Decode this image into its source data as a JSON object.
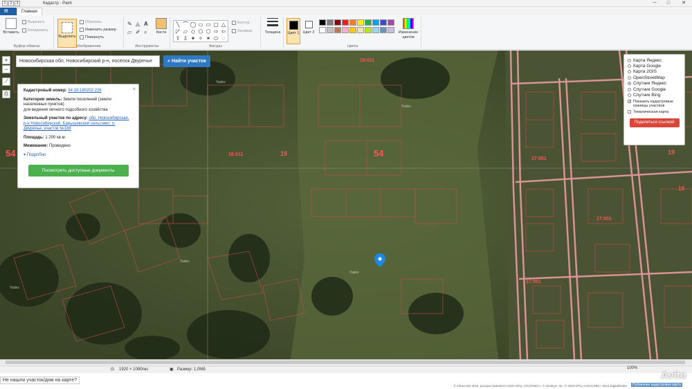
{
  "window": {
    "title": "Кадастр - Paint",
    "quick_access": [
      "1",
      "2",
      "3"
    ],
    "controls": {
      "minimize": "─",
      "maximize": "□",
      "close": "✕"
    }
  },
  "tabs": [
    {
      "label": "Главная",
      "active": true
    }
  ],
  "ribbon": {
    "clipboard": {
      "paste": "Вставить",
      "cut": "Вырезать",
      "copy": "Копировать",
      "group": "Буфер обмена"
    },
    "image": {
      "select": "Выделить",
      "crop": "Обрезать",
      "resize": "Изменить размер",
      "rotate": "Повернуть",
      "group": "Изображение"
    },
    "tools": {
      "group": "Инструменты",
      "brushes": "Кисти"
    },
    "shapes": {
      "group": "Фигуры",
      "outline": "Контур",
      "fill": "Заливка",
      "glyphs": [
        "╲",
        "⌒",
        "◯",
        "▭",
        "▭",
        "▢",
        "△",
        "◸",
        "▱",
        "◇",
        "⬠",
        "⬡",
        "⇨",
        "⇦",
        "⇧",
        "⇩",
        "✦",
        "✧",
        "✶",
        "⬭",
        "◌"
      ]
    },
    "thickness": "Толщина",
    "colors": {
      "group": "Цвета",
      "color1": "Цвет 1",
      "color2": "Цвет 2",
      "edit": "Изменение цветов",
      "palette": [
        "#000000",
        "#7f7f7f",
        "#880015",
        "#ed1c24",
        "#ff7f27",
        "#fff200",
        "#22b14c",
        "#00a2e8",
        "#3f48cc",
        "#a349a4",
        "#ffffff",
        "#c3c3c3",
        "#b97a57",
        "#ffaec9",
        "#ffc90e",
        "#efe4b0",
        "#b5e61d",
        "#99d9ea",
        "#7092be",
        "#c8bfe7"
      ],
      "color1_value": "#000000",
      "color2_value": "#ffffff"
    }
  },
  "search": {
    "value": "Новосибирская обл, Новосибирский р-н, поселок Двуречье",
    "button": "Найти участок"
  },
  "zoom": {
    "plus": "+",
    "minus": "−"
  },
  "info": {
    "close": "×",
    "cadastral_label": "Кадастровый номер:",
    "cadastral_value": "54:19:180202:226",
    "category_label": "Категория земель:",
    "category_value": "Земли поселений (земли населенных пунктов)",
    "use_value": "для ведения личного подсобного хозяйства",
    "address_label": "Земельный участок по адресу:",
    "address_value": "обл. Новосибирская, р-н Новосибирский, Барышевский сельсовет, п. Двуречье, участок №188",
    "area_label": "Площадь:",
    "area_value": "1 200 кв.м.",
    "survey_label": "Межевание:",
    "survey_value": "Проведено",
    "more": "Подробно",
    "docs_button": "Посмотреть доступные документы"
  },
  "layers": {
    "options": [
      {
        "label": "Карта Яндекс",
        "on": false
      },
      {
        "label": "Карта Google",
        "on": false
      },
      {
        "label": "Карта 2GIS",
        "on": false
      },
      {
        "label": "OpenStreetMap",
        "on": false
      },
      {
        "label": "Спутник Яндекс",
        "on": true
      },
      {
        "label": "Спутник Google",
        "on": false
      },
      {
        "label": "Спутник Bing",
        "on": false
      }
    ],
    "show_borders": "Показать кадастровые границы участков",
    "thematic": "Тематическая карта",
    "share": "Поделиться ссылкой"
  },
  "map_labels": {
    "big": [
      "54",
      "54",
      "19",
      "19",
      "19"
    ],
    "quarters": [
      "16:011",
      "17:001",
      "17:001",
      "17:001",
      "16:011"
    ],
    "yadex": "Yadex"
  },
  "status": {
    "dims": "1920 × 1080пкс",
    "size": "Размер: 1,0МБ",
    "zoom": "100%"
  },
  "not_found": "Не нашли участок/дом на карте?",
  "copyright": "© Airbus DS 2016, распространяется ООО ИТЦ «СКАНЭКС», © GeoEye, Inc. © ООО ИТЦ «СКАНЭКС» 2012 DigitalGlobe",
  "watermark": "Avito",
  "pubmap": "Публичная кадастровая карта"
}
